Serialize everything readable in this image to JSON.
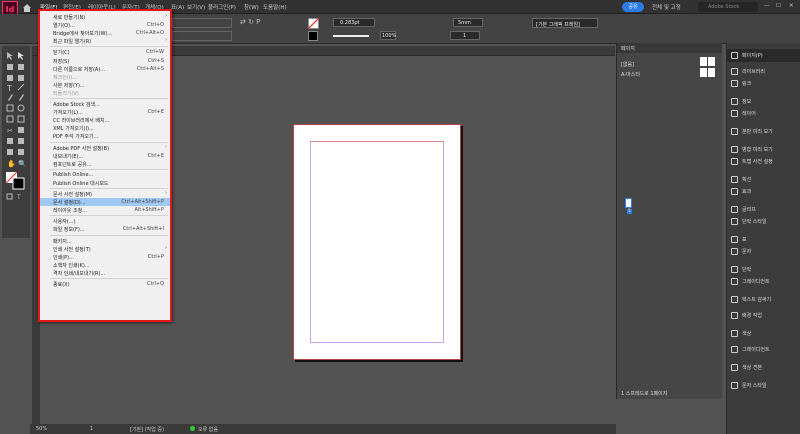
{
  "app": {
    "logo": "Id"
  },
  "menubar": {
    "items": [
      "파일(F)",
      "편집(E)",
      "레이아웃(L)",
      "문자(T)",
      "개체(O)",
      "표(A)",
      "보기(V)",
      "플러그인(P)",
      "창(W)",
      "도움말(H)"
    ],
    "share_label": "공유",
    "workspace_label": "전체 및 고정",
    "search_placeholder": "Adobe Stock"
  },
  "controlbar": {
    "stroke_weight": "0.283pt",
    "spacing": "5mm",
    "zoom_percent": "100%",
    "frame_style": "[기본 그래픽 프레임]",
    "number_one": "1"
  },
  "file_menu": {
    "items": [
      {
        "label": "새로 만들기(N)",
        "shortcut": "",
        "submenu": true,
        "disabled": false
      },
      {
        "label": "열기(O)...",
        "shortcut": "Ctrl+O",
        "submenu": false,
        "disabled": false
      },
      {
        "label": "Bridge에서 찾아보기(W)...",
        "shortcut": "Ctrl+Alt+O",
        "submenu": false,
        "disabled": false
      },
      {
        "label": "최근 파일 열기(R)",
        "shortcut": "",
        "submenu": true,
        "disabled": false
      },
      {
        "sep": true
      },
      {
        "label": "닫기(C)",
        "shortcut": "Ctrl+W",
        "submenu": false,
        "disabled": false
      },
      {
        "label": "저장(S)",
        "shortcut": "Ctrl+S",
        "submenu": false,
        "disabled": false
      },
      {
        "label": "다른 이름으로 저장(A)...",
        "shortcut": "Ctrl+Alt+S",
        "submenu": false,
        "disabled": false
      },
      {
        "label": "체크인(I)...",
        "shortcut": "",
        "submenu": false,
        "disabled": true
      },
      {
        "label": "사본 저장(Y)...",
        "shortcut": "",
        "submenu": false,
        "disabled": false
      },
      {
        "label": "되돌리기(V)",
        "shortcut": "",
        "submenu": false,
        "disabled": true
      },
      {
        "sep": true
      },
      {
        "label": "Adobe Stock 검색...",
        "shortcut": "",
        "submenu": false,
        "disabled": false
      },
      {
        "label": "가져오기(L)...",
        "shortcut": "Ctrl+E",
        "submenu": false,
        "disabled": false
      },
      {
        "label": "CC 라이브러리에서 배치...",
        "shortcut": "",
        "submenu": false,
        "disabled": false
      },
      {
        "label": "XML 가져오기(I)...",
        "shortcut": "",
        "submenu": false,
        "disabled": false
      },
      {
        "label": "PDF 주석 가져오기...",
        "shortcut": "",
        "submenu": false,
        "disabled": false
      },
      {
        "sep": true
      },
      {
        "label": "Adobe PDF 사전 설정(B)",
        "shortcut": "",
        "submenu": true,
        "disabled": false
      },
      {
        "label": "내보내기(E)...",
        "shortcut": "Ctrl+E",
        "submenu": false,
        "disabled": false
      },
      {
        "label": "컴포넌트로 공유...",
        "shortcut": "",
        "submenu": false,
        "disabled": false
      },
      {
        "sep": true
      },
      {
        "label": "Publish Online...",
        "shortcut": "",
        "submenu": false,
        "disabled": false
      },
      {
        "label": "Publish Online 대시보드",
        "shortcut": "",
        "submenu": false,
        "disabled": false
      },
      {
        "sep": true
      },
      {
        "label": "문서 사전 설정(M)",
        "shortcut": "",
        "submenu": true,
        "disabled": false
      },
      {
        "label": "문서 설정(D)...",
        "shortcut": "Ctrl+Alt+Shift+P",
        "submenu": false,
        "disabled": false,
        "highlight": true
      },
      {
        "label": "레이아웃 조정...",
        "shortcut": "Alt+Shift+P",
        "submenu": false,
        "disabled": false
      },
      {
        "sep": true
      },
      {
        "label": "사용자(...)",
        "shortcut": "",
        "submenu": false,
        "disabled": false
      },
      {
        "label": "파일 정보(F)...",
        "shortcut": "Ctrl+Alt+Shift+I",
        "submenu": false,
        "disabled": false
      },
      {
        "sep": true
      },
      {
        "label": "패키지...",
        "shortcut": "",
        "submenu": false,
        "disabled": false
      },
      {
        "label": "인쇄 사전 설정(T)",
        "shortcut": "",
        "submenu": true,
        "disabled": false
      },
      {
        "label": "인쇄(P)...",
        "shortcut": "Ctrl+P",
        "submenu": false,
        "disabled": false
      },
      {
        "label": "소책자 인쇄(K)...",
        "shortcut": "",
        "submenu": false,
        "disabled": false
      },
      {
        "label": "격자 인쇄/내보내기(R)...",
        "shortcut": "",
        "submenu": false,
        "disabled": false
      },
      {
        "sep": true
      },
      {
        "label": "종료(X)",
        "shortcut": "Ctrl+Q",
        "submenu": false,
        "disabled": false
      }
    ]
  },
  "pages_panel": {
    "tab": "페이지",
    "none_label": "[없음]",
    "master_label": "A-마스터",
    "page_number": "1",
    "footer": "1 스프레드로 1페이지"
  },
  "right_panel": {
    "items": [
      {
        "icon": "pages-icon",
        "label": "페이지(P)",
        "selected": true
      },
      {
        "icon": "cc-libraries-icon",
        "label": "라이브러리"
      },
      {
        "icon": "links-icon",
        "label": "링크"
      },
      {
        "icon": "info-icon",
        "label": "정보"
      },
      {
        "icon": "layers-icon",
        "label": "레이어"
      },
      {
        "icon": "preflight-icon",
        "label": "분판 미리 보기"
      },
      {
        "icon": "flattener-icon",
        "label": "병합 미리 보기"
      },
      {
        "icon": "trap-icon",
        "label": "트랩 사전 설정"
      },
      {
        "icon": "stroke-icon",
        "label": "획선"
      },
      {
        "icon": "effects-icon",
        "label": "효과"
      },
      {
        "icon": "glyphs-icon",
        "label": "글리프"
      },
      {
        "icon": "paragraph-style-icon",
        "label": "단락 스타일"
      },
      {
        "icon": "table-icon",
        "label": "표"
      },
      {
        "icon": "character-icon",
        "label": "문자"
      },
      {
        "icon": "paragraph-icon",
        "label": "단락"
      },
      {
        "icon": "gradient-icon",
        "label": "그레이디언트"
      },
      {
        "icon": "text-wrap-icon",
        "label": "텍스트 감싸기"
      },
      {
        "icon": "align-icon",
        "label": "배경 작업"
      },
      {
        "icon": "color-icon",
        "label": "색상"
      },
      {
        "icon": "gradient2-icon",
        "label": "그레이디언트"
      },
      {
        "icon": "swatches-icon",
        "label": "색상 견본"
      },
      {
        "icon": "char-style-icon",
        "label": "문자 스타일"
      }
    ]
  },
  "statusbar": {
    "zoom": "50%",
    "page": "1",
    "style": "[기본] (작업 중)",
    "errors": "오류 없음"
  }
}
